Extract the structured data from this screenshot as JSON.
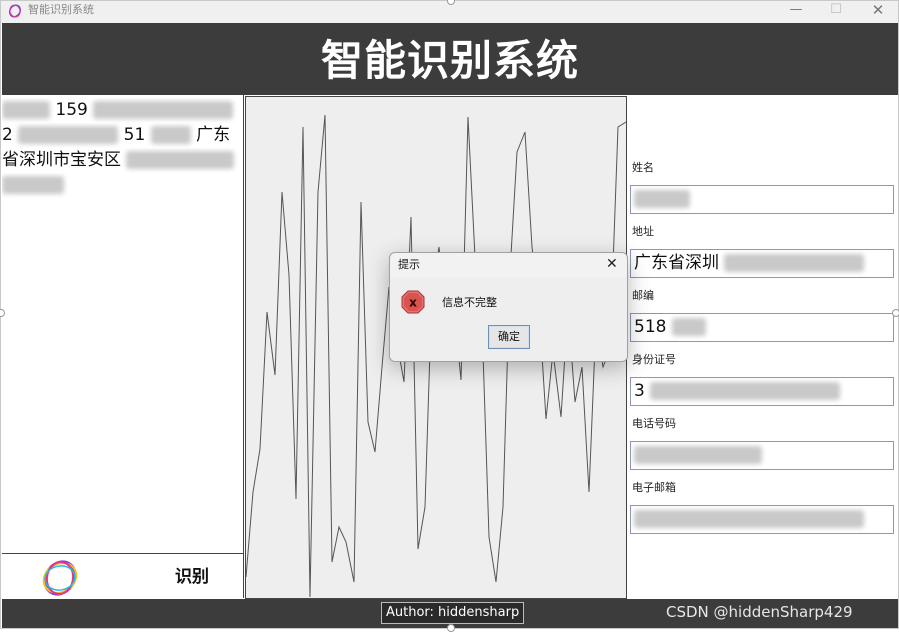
{
  "window": {
    "title": "智能识别系统",
    "controls": {
      "minimize": "—",
      "maximize": "☐",
      "close": "✕"
    }
  },
  "header": {
    "title": "智能识别系统"
  },
  "ocr_result": {
    "lines": [
      {
        "prefix": "",
        "visible": "159",
        "suffix": ""
      },
      {
        "prefix": "2",
        "visible": "51",
        "suffix": "广东"
      },
      {
        "prefix": "",
        "visible": "省深圳市宝安区",
        "suffix": ""
      }
    ]
  },
  "recognize_button": {
    "label": "识别"
  },
  "form": {
    "name": {
      "label": "姓名",
      "value": ""
    },
    "address": {
      "label": "地址",
      "value": "广东省深圳"
    },
    "postcode": {
      "label": "邮编",
      "value": "518"
    },
    "id_number": {
      "label": "身份证号",
      "value": "3"
    },
    "phone": {
      "label": "电话号码",
      "value": ""
    },
    "email": {
      "label": "电子邮箱",
      "value": ""
    }
  },
  "footer": {
    "author": "Author: hiddensharp",
    "watermark": "CSDN @hiddenSharp429"
  },
  "dialog": {
    "title": "提示",
    "close": "✕",
    "message": "信息不完整",
    "ok_label": "确定"
  },
  "colors": {
    "dark_bar": "#3c3c3c",
    "plot_bg": "#eeeeee",
    "error_red": "#c0392b"
  },
  "icons": {
    "app": "app-logo-icon",
    "brand": "ring-logo-icon",
    "error": "error-x-icon"
  }
}
